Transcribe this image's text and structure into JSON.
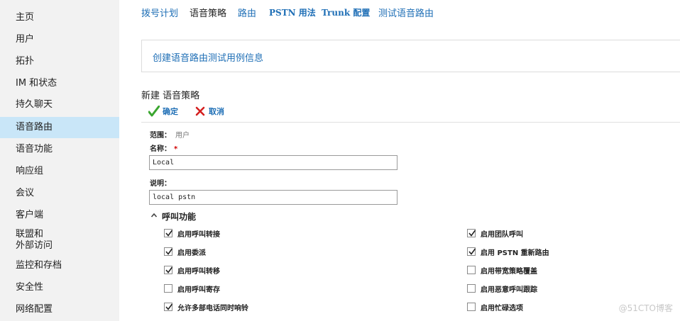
{
  "sidebar": {
    "items": [
      {
        "label": "主页"
      },
      {
        "label": "用户"
      },
      {
        "label": "拓扑"
      },
      {
        "label": "IM 和状态"
      },
      {
        "label": "持久聊天"
      },
      {
        "label": "语音路由",
        "active": true
      },
      {
        "label": "语音功能"
      },
      {
        "label": "响应组"
      },
      {
        "label": "会议"
      },
      {
        "label": "客户端"
      },
      {
        "label_line1": "联盟和",
        "label_line2": "外部访问"
      },
      {
        "label": "监控和存档"
      },
      {
        "label": "安全性"
      },
      {
        "label": "网络配置"
      }
    ]
  },
  "topnav": {
    "tabs": [
      {
        "label": "拨号计划"
      },
      {
        "label": "语音策略",
        "active": true
      },
      {
        "label": "路由"
      },
      {
        "label": "PSTN 用法"
      },
      {
        "label": "Trunk 配置"
      },
      {
        "label": "测试语音路由"
      }
    ]
  },
  "info_box": {
    "text": "创建语音路由测试用例信息"
  },
  "page_title": "新建 语音策略",
  "toolbar": {
    "ok_label": "确定",
    "cancel_label": "取消"
  },
  "form": {
    "scope_label": "范围：",
    "scope_value": "用户",
    "name_label": "名称：",
    "name_required": "*",
    "name_value": "Local",
    "desc_label": "说明：",
    "desc_value": "local pstn"
  },
  "calling_features": {
    "title": "呼叫功能",
    "left": [
      {
        "label": "启用呼叫转接",
        "checked": true
      },
      {
        "label": "启用委派",
        "checked": true
      },
      {
        "label": "启用呼叫转移",
        "checked": true
      },
      {
        "label": "启用呼叫寄存",
        "checked": false
      },
      {
        "label": "允许多部电话同时响铃",
        "checked": true
      }
    ],
    "right": [
      {
        "label": "启用团队呼叫",
        "checked": true
      },
      {
        "label": "启用 PSTN 重新路由",
        "checked": true
      },
      {
        "label": "启用带宽策略覆盖",
        "checked": false
      },
      {
        "label": "启用恶意呼叫跟踪",
        "checked": false
      },
      {
        "label": "启用忙碌选项",
        "checked": false
      }
    ]
  },
  "watermark": "@51CTO博客",
  "colors": {
    "link": "#1f6fb6",
    "sidebar_bg": "#f2f2f2",
    "sidebar_active": "#c9e6f8",
    "ok_green": "#3aa62f",
    "cancel_red": "#d42020",
    "required_red": "#d00000"
  }
}
